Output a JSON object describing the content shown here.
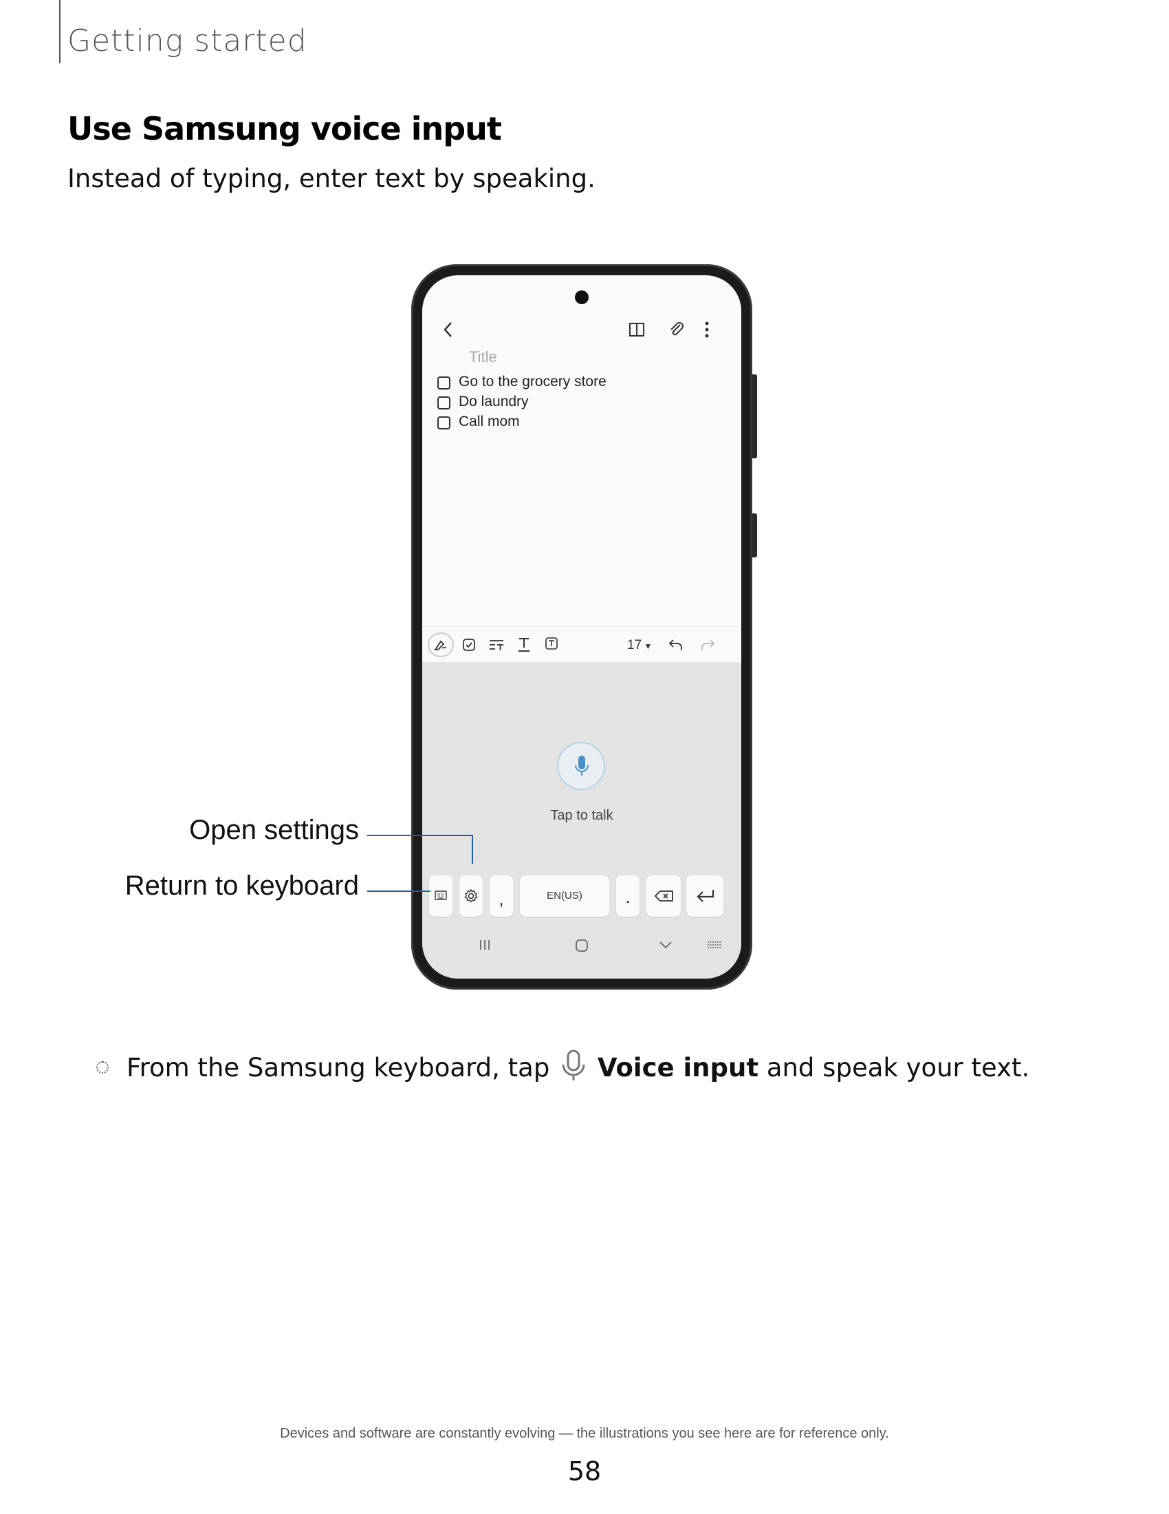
{
  "header": {
    "section": "Getting started"
  },
  "heading": "Use Samsung voice input",
  "intro": "Instead of typing, enter text by speaking.",
  "phone": {
    "title_placeholder": "Title",
    "notes": [
      "Go to the grocery store",
      "Do laundry",
      "Call mom"
    ],
    "font_size": "17",
    "tap_to_talk": "Tap to talk",
    "keys": {
      "comma": ",",
      "language": "EN(US)",
      "period": "."
    }
  },
  "callouts": {
    "open_settings": "Open settings",
    "return_to_keyboard": "Return to keyboard"
  },
  "step": {
    "prefix": "From the Samsung keyboard, tap",
    "bold": "Voice input",
    "suffix": "and speak your text."
  },
  "footer": {
    "note": "Devices and software are constantly evolving — the illustrations you see here are for reference only.",
    "page_number": "58"
  },
  "icons": [
    "back-icon",
    "book-icon",
    "attach-icon",
    "more-icon",
    "pen-icon",
    "checkbox-icon",
    "text-format-icon",
    "underline-icon",
    "textbox-icon",
    "undo-icon",
    "redo-icon",
    "mic-icon",
    "keyboard-icon",
    "gear-icon",
    "backspace-icon",
    "enter-icon",
    "recent-apps-icon",
    "home-icon",
    "hide-keyboard-icon",
    "keyboard-grid-icon"
  ],
  "colors": {
    "callout_line": "#1f5fa8",
    "mic_blue": "#4a90c8"
  }
}
